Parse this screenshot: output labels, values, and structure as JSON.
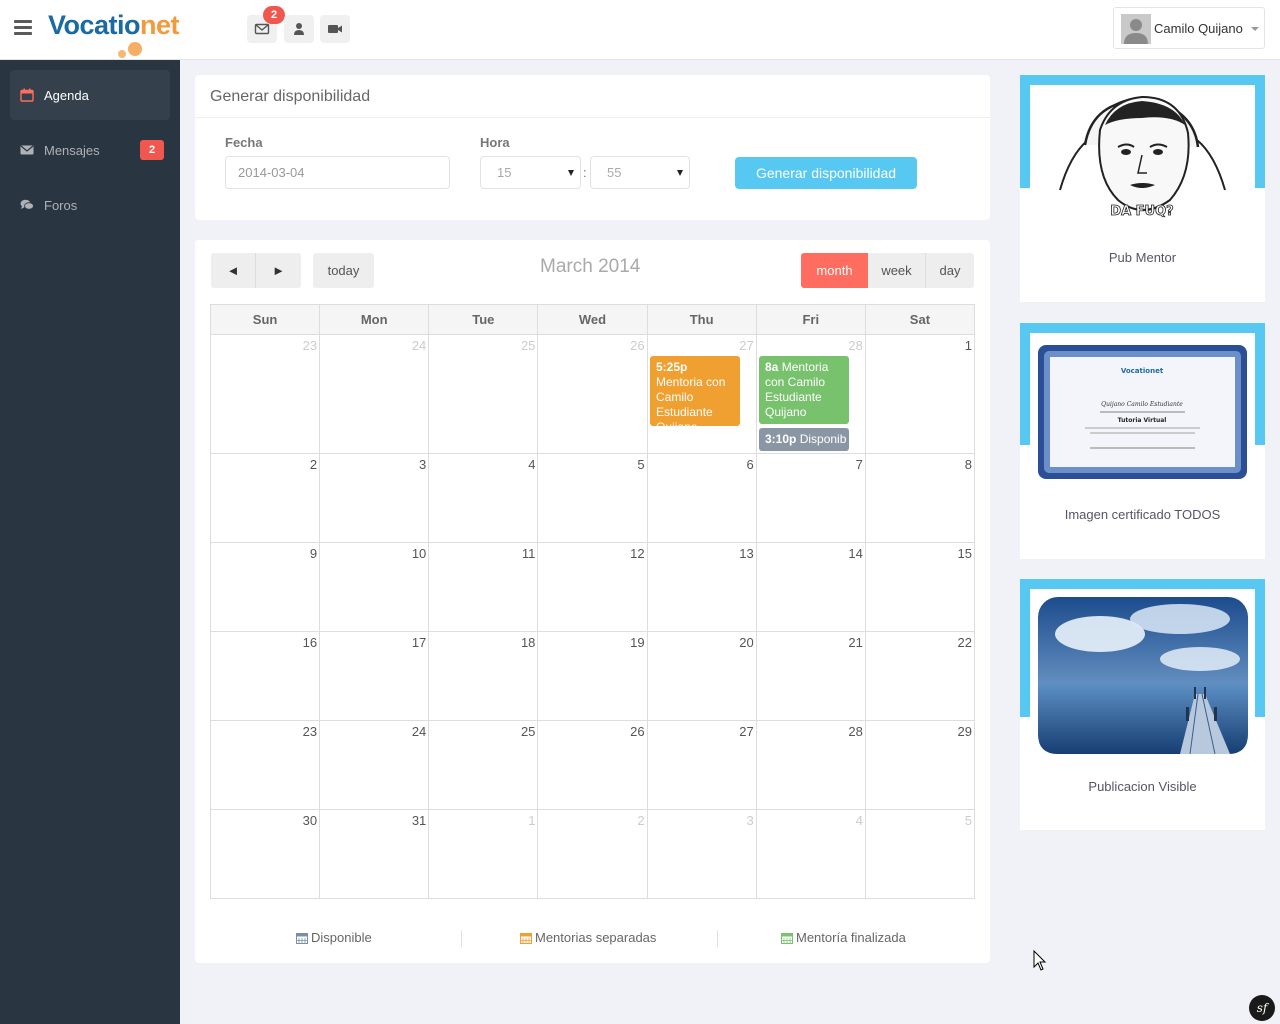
{
  "header": {
    "logo_main": "Vocatio",
    "logo_accent": "net",
    "notifications_count": "2",
    "user_name": "Camilo Quijano"
  },
  "sidebar": {
    "items": [
      {
        "label": "Agenda",
        "icon": "calendar-icon",
        "active": true
      },
      {
        "label": "Mensajes",
        "icon": "envelope-icon",
        "badge": "2"
      },
      {
        "label": "Foros",
        "icon": "comments-icon"
      }
    ]
  },
  "generate": {
    "title": "Generar disponibilidad",
    "fecha_label": "Fecha",
    "fecha_value": "2014-03-04",
    "hora_label": "Hora",
    "hour_value": "15",
    "minute_value": "55",
    "separator": ":",
    "button_label": "Generar disponibilidad"
  },
  "calendar": {
    "title": "March 2014",
    "prev": "◄",
    "next": "►",
    "today": "today",
    "views": {
      "month": "month",
      "week": "week",
      "day": "day"
    },
    "weekdays": [
      "Sun",
      "Mon",
      "Tue",
      "Wed",
      "Thu",
      "Fri",
      "Sat"
    ],
    "weeks": [
      [
        {
          "d": "23",
          "o": true
        },
        {
          "d": "24",
          "o": true
        },
        {
          "d": "25",
          "o": true
        },
        {
          "d": "26",
          "o": true
        },
        {
          "d": "27",
          "o": true
        },
        {
          "d": "28",
          "o": true
        },
        {
          "d": "1"
        }
      ],
      [
        {
          "d": "2"
        },
        {
          "d": "3"
        },
        {
          "d": "4"
        },
        {
          "d": "5"
        },
        {
          "d": "6"
        },
        {
          "d": "7"
        },
        {
          "d": "8"
        }
      ],
      [
        {
          "d": "9"
        },
        {
          "d": "10"
        },
        {
          "d": "11"
        },
        {
          "d": "12"
        },
        {
          "d": "13"
        },
        {
          "d": "14"
        },
        {
          "d": "15"
        }
      ],
      [
        {
          "d": "16"
        },
        {
          "d": "17"
        },
        {
          "d": "18"
        },
        {
          "d": "19"
        },
        {
          "d": "20"
        },
        {
          "d": "21"
        },
        {
          "d": "22"
        }
      ],
      [
        {
          "d": "23"
        },
        {
          "d": "24"
        },
        {
          "d": "25"
        },
        {
          "d": "26"
        },
        {
          "d": "27"
        },
        {
          "d": "28"
        },
        {
          "d": "29"
        }
      ],
      [
        {
          "d": "30"
        },
        {
          "d": "31"
        },
        {
          "d": "1",
          "o": true
        },
        {
          "d": "2",
          "o": true
        },
        {
          "d": "3",
          "o": true
        },
        {
          "d": "4",
          "o": true
        },
        {
          "d": "5",
          "o": true
        }
      ]
    ],
    "events": [
      {
        "time": "5:25p",
        "title": "Mentoria con Camilo Estudiante Quijano",
        "color": "#f0a030"
      },
      {
        "time": "8a",
        "title": "Mentoria con Camilo Estudiante Quijano",
        "color": "#78c26e"
      },
      {
        "time": "3:10p",
        "title": "Disponib",
        "color": "#8a96a3"
      }
    ],
    "legend": [
      {
        "label": "Disponible",
        "color": "#7a8ea8"
      },
      {
        "label": "Mentorias separadas",
        "color": "#f0a030"
      },
      {
        "label": "Mentoría finalizada",
        "color": "#78c26e"
      }
    ]
  },
  "cards": [
    {
      "label": "Pub Mentor",
      "image": "meme-face-image",
      "caption": "DA FUQ?"
    },
    {
      "label": "Imagen certificado TODOS",
      "image": "certificate-image",
      "cert_name": "Quijano Camilo Estudiante",
      "cert_course": "Tutoria Virtual"
    },
    {
      "label": "Publicacion Visible",
      "image": "pier-sky-image"
    }
  ],
  "colors": {
    "sidebar_bg": "#2a3542",
    "accent_red": "#ff6c60",
    "accent_blue": "#57c8f2"
  }
}
